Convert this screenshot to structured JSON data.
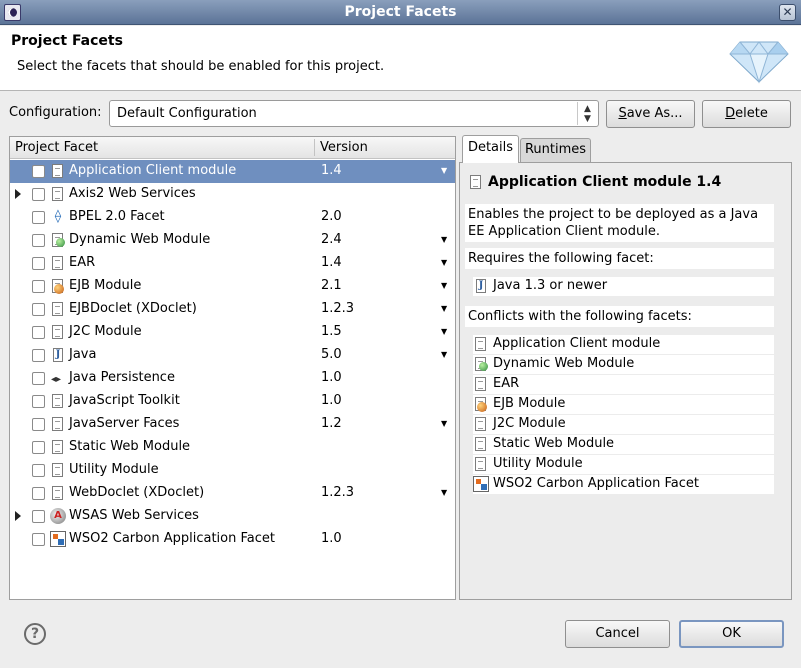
{
  "window": {
    "title": "Project Facets",
    "close_glyph": "✕"
  },
  "header": {
    "title": "Project Facets",
    "message": "Select the facets that should be enabled for this project."
  },
  "configuration": {
    "label": "Configuration:",
    "value": "Default Configuration",
    "spinner_up": "▲",
    "spinner_down": "▼",
    "save_as_label_mn": "S",
    "save_as_label_rest": "ave As...",
    "delete_label_mn": "D",
    "delete_label_rest": "elete"
  },
  "table": {
    "col_facet": "Project Facet",
    "col_version": "Version",
    "rows": [
      {
        "name": "Application Client module",
        "version": "1.4",
        "icon": "doc-icon",
        "expandable": false,
        "dropdown": true,
        "selected": true
      },
      {
        "name": "Axis2 Web Services",
        "version": "",
        "icon": "doc-icon",
        "expandable": true,
        "dropdown": false,
        "selected": false
      },
      {
        "name": "BPEL 2.0 Facet",
        "version": "2.0",
        "icon": "bpel-icon",
        "expandable": false,
        "dropdown": false,
        "selected": false
      },
      {
        "name": "Dynamic Web Module",
        "version": "2.4",
        "icon": "globe-icon",
        "expandable": false,
        "dropdown": true,
        "selected": false
      },
      {
        "name": "EAR",
        "version": "1.4",
        "icon": "doc-icon",
        "expandable": false,
        "dropdown": true,
        "selected": false
      },
      {
        "name": "EJB Module",
        "version": "2.1",
        "icon": "bean-icon",
        "expandable": false,
        "dropdown": true,
        "selected": false
      },
      {
        "name": "EJBDoclet (XDoclet)",
        "version": "1.2.3",
        "icon": "doc-icon",
        "expandable": false,
        "dropdown": true,
        "selected": false
      },
      {
        "name": "J2C Module",
        "version": "1.5",
        "icon": "doc-icon",
        "expandable": false,
        "dropdown": true,
        "selected": false
      },
      {
        "name": "Java",
        "version": "5.0",
        "icon": "java-icon",
        "expandable": false,
        "dropdown": true,
        "selected": false
      },
      {
        "name": "Java Persistence",
        "version": "1.0",
        "icon": "java-persistence-icon",
        "expandable": false,
        "dropdown": false,
        "selected": false
      },
      {
        "name": "JavaScript Toolkit",
        "version": "1.0",
        "icon": "doc-icon",
        "expandable": false,
        "dropdown": false,
        "selected": false
      },
      {
        "name": "JavaServer Faces",
        "version": "1.2",
        "icon": "doc-icon",
        "expandable": false,
        "dropdown": true,
        "selected": false
      },
      {
        "name": "Static Web Module",
        "version": "",
        "icon": "doc-icon",
        "expandable": false,
        "dropdown": false,
        "selected": false
      },
      {
        "name": "Utility Module",
        "version": "",
        "icon": "doc-icon",
        "expandable": false,
        "dropdown": false,
        "selected": false
      },
      {
        "name": "WebDoclet (XDoclet)",
        "version": "1.2.3",
        "icon": "doc-icon",
        "expandable": false,
        "dropdown": true,
        "selected": false
      },
      {
        "name": "WSAS Web Services",
        "version": "",
        "icon": "wsas-icon",
        "expandable": true,
        "dropdown": false,
        "selected": false
      },
      {
        "name": "WSO2 Carbon Application Facet",
        "version": "1.0",
        "icon": "wso2-icon",
        "expandable": false,
        "dropdown": false,
        "selected": false
      }
    ]
  },
  "details": {
    "tab_details": "Details",
    "tab_runtimes": "Runtimes",
    "title": "Application Client module 1.4",
    "description": "Enables the project to be deployed as a Java EE Application Client module.",
    "requires_heading": "Requires the following facet:",
    "requires": [
      {
        "name": "Java 1.3 or newer",
        "icon": "java-icon"
      }
    ],
    "conflicts_heading": "Conflicts with the following facets:",
    "conflicts": [
      {
        "name": "Application Client module",
        "icon": "doc-icon"
      },
      {
        "name": "Dynamic Web Module",
        "icon": "globe-icon"
      },
      {
        "name": "EAR",
        "icon": "doc-icon"
      },
      {
        "name": "EJB Module",
        "icon": "bean-icon"
      },
      {
        "name": "J2C Module",
        "icon": "doc-icon"
      },
      {
        "name": "Static Web Module",
        "icon": "doc-icon"
      },
      {
        "name": "Utility Module",
        "icon": "doc-icon"
      },
      {
        "name": "WSO2 Carbon Application Facet",
        "icon": "wso2-icon"
      }
    ]
  },
  "footer": {
    "help_glyph": "?",
    "cancel_label": "Cancel",
    "ok_label": "OK"
  },
  "colors": {
    "title_bar": "#6f86a8",
    "selection": "#6f8fbf",
    "background": "#ededed"
  }
}
